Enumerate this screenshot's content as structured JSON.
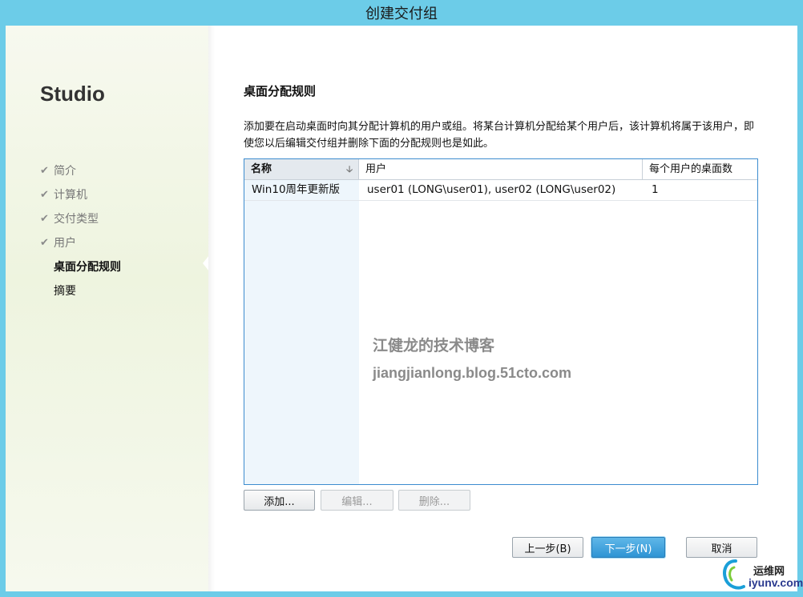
{
  "window": {
    "title": "创建交付组"
  },
  "sidebar": {
    "brand": "Studio",
    "steps": [
      {
        "label": "简介",
        "state": "done"
      },
      {
        "label": "计算机",
        "state": "done"
      },
      {
        "label": "交付类型",
        "state": "done"
      },
      {
        "label": "用户",
        "state": "done"
      },
      {
        "label": "桌面分配规则",
        "state": "active"
      },
      {
        "label": "摘要",
        "state": "pending"
      }
    ]
  },
  "main": {
    "heading": "桌面分配规则",
    "description": "添加要在启动桌面时向其分配计算机的用户或组。将某台计算机分配给某个用户后，该计算机将属于该用户，即使您以后编辑交付组并删除下面的分配规则也是如此。",
    "table": {
      "columns": [
        "名称",
        "用户",
        "每个用户的桌面数"
      ],
      "rows": [
        {
          "name": "Win10周年更新版",
          "users": "user01 (LONG\\user01), user02 (LONG\\user02)",
          "count": "1"
        }
      ]
    },
    "watermark": {
      "line1": "江健龙的技术博客",
      "line2": "jiangjianlong.blog.51cto.com"
    },
    "buttons": {
      "add": "添加...",
      "edit": "编辑...",
      "delete": "删除..."
    }
  },
  "footer": {
    "back": "上一步(B)",
    "next": "下一步(N)",
    "cancel": "取消"
  },
  "logo": {
    "text1": "运维网",
    "text2": "iyunv.com"
  },
  "icons": {
    "checkmark": "checkmark-icon",
    "sort": "sort-arrow-icon",
    "logo": "iyunv-logo-icon"
  },
  "colors": {
    "titlebar": "#6ccce8",
    "primary_button": "#2e94d4",
    "grid_border": "#3c8ccf"
  }
}
